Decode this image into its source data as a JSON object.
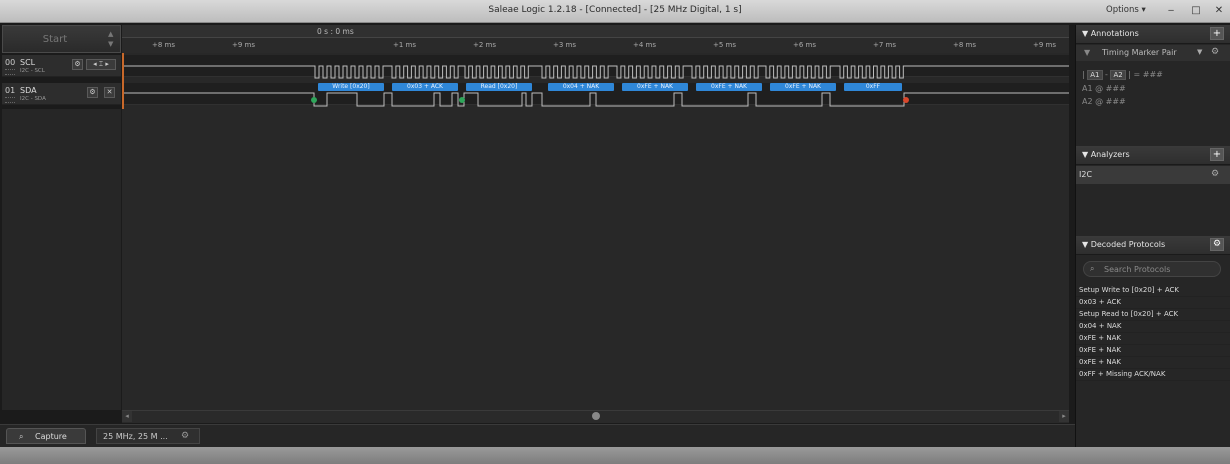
{
  "window": {
    "title": "Saleae Logic 1.2.18 - [Connected] - [25 MHz Digital, 1 s]",
    "options_label": "Options ▾",
    "minimize": "‒",
    "maximize": "□",
    "close": "✕"
  },
  "left": {
    "start_label": "Start",
    "channels": [
      {
        "num": "00",
        "name": "SCL",
        "sub": "I2C - SCL"
      },
      {
        "num": "01",
        "name": "SDA",
        "sub": "I2C - SDA"
      }
    ]
  },
  "ruler": {
    "zero_label": "0 s : 0 ms",
    "ticks": [
      "+8 ms",
      "+9 ms",
      "+1 ms",
      "+2 ms",
      "+3 ms",
      "+4 ms",
      "+5 ms",
      "+6 ms",
      "+7 ms",
      "+8 ms",
      "+9 ms"
    ]
  },
  "decoded_bubbles": [
    "Write [0x20]",
    "0x03 + ACK",
    "Read [0x20]",
    "0x04 + NAK",
    "0xFE + NAK",
    "0xFE + NAK",
    "0xFE + NAK",
    "0xFF"
  ],
  "bottom": {
    "capture_tab": "Capture",
    "session_tab": "25 MHz, 25 M ..."
  },
  "annotations": {
    "title": "Annotations",
    "timing_pair": "Timing Marker Pair",
    "formula_prefix": "|",
    "a1": "A1",
    "minus": "-",
    "a2": "A2",
    "formula_suffix": "| = ###",
    "a1_row": "A1  @  ###",
    "a2_row": "A2  @  ###"
  },
  "analyzers": {
    "title": "Analyzers",
    "items": [
      "I2C"
    ]
  },
  "decoded": {
    "title": "Decoded Protocols",
    "search_placeholder": "Search Protocols",
    "rows": [
      "Setup Write to [0x20] + ACK",
      "0x03 + ACK",
      "Setup Read to [0x20] + ACK",
      "0x04 + NAK",
      "0xFE + NAK",
      "0xFE + NAK",
      "0xFE + NAK",
      "0xFF + Missing ACK/NAK"
    ]
  },
  "icons": {
    "gear": "gear-icon",
    "search": "search-icon",
    "plus": "plus-icon",
    "triangle": "collapse-triangle-icon"
  },
  "colors": {
    "accent": "#2f87d8",
    "marker": "#c8682a",
    "start_dot": "#2fa65b",
    "end_dot": "#d9472b"
  }
}
